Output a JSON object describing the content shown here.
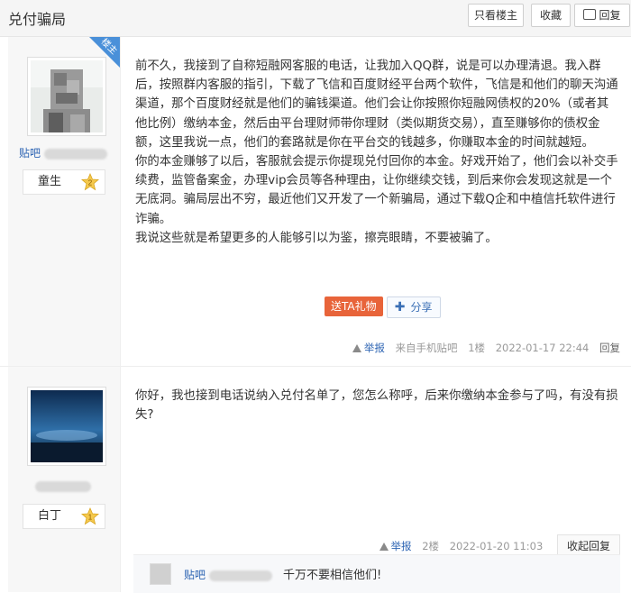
{
  "header": {
    "title": "兑付骗局",
    "only_op_label": "只看楼主",
    "favorite_label": "收藏",
    "reply_label": "回复"
  },
  "post1": {
    "louzhu_badge": "楼主",
    "user_prefix": "贴吧",
    "level_name": "童生",
    "level_num": "2",
    "paragraphs": [
      "前不久，我接到了自称短融网客服的电话，让我加入QQ群，说是可以办理清退。我入群后，按照群内客服的指引，下载了飞信和百度财经平台两个软件，飞信是和他们的聊天沟通渠道，那个百度财经就是他们的骗钱渠道。他们会让你按照你短融网债权的20%（或者其他比例）缴纳本金，然后由平台理财师带你理财（类似期货交易），直至赚够你的债权金额，这里我说一点，他们的套路就是你在平台交的钱越多，你赚取本金的时间就越短。",
      "你的本金赚够了以后，客服就会提示你提现兑付回你的本金。好戏开始了，他们会以补交手续费，监管备案金，办理vip会员等各种理由，让你继续交钱，到后来你会发现这就是一个无底洞。骗局层出不穷，最近他们又开发了一个新骗局，通过下载Q企和中植信托软件进行诈骗。",
      "我说这些就是希望更多的人能够引以为鉴，擦亮眼睛，不要被骗了。"
    ],
    "gift_label": "送TA礼物",
    "share_label": "分享",
    "report_label": "举报",
    "source": "来自手机贴吧",
    "floor": "1楼",
    "time": "2022-01-17 22:44",
    "reply_link": "回复"
  },
  "post2": {
    "level_name": "白丁",
    "level_num": "1",
    "text": "你好，我也接到电话说纳入兑付名单了，您怎么称呼，后来你缴纳本金参与了吗，有没有损失?",
    "report_label": "举报",
    "floor": "2楼",
    "time": "2022-01-20 11:03",
    "collapse_label": "收起回复",
    "lzl_user_prefix": "贴吧",
    "lzl_text": "千万不要相信他们!"
  },
  "colors": {
    "accent_blue": "#2d64b3",
    "gift_orange": "#e8643a",
    "badge_blue": "#4a90d9"
  }
}
